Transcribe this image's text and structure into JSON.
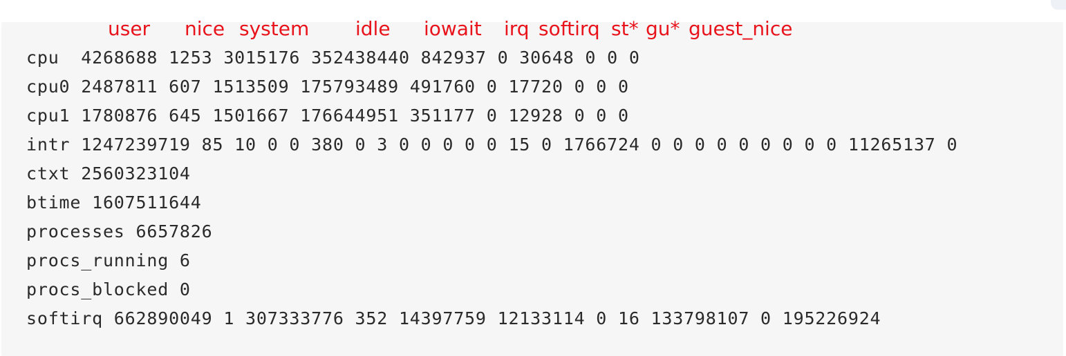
{
  "colors": {
    "header_text": "#e8131b",
    "code_text": "#2a2a2a",
    "background": "#f6f6f6"
  },
  "header_labels": [
    "user",
    "nice",
    "system",
    "idle",
    "iowait",
    "irq",
    "softirq",
    "st*",
    "gu*",
    "guest_nice"
  ],
  "lines": [
    "cpu  4268688 1253 3015176 352438440 842937 0 30648 0 0 0",
    "cpu0 2487811 607 1513509 175793489 491760 0 17720 0 0 0",
    "cpu1 1780876 645 1501667 176644951 351177 0 12928 0 0 0",
    "intr 1247239719 85 10 0 0 380 0 3 0 0 0 0 0 15 0 1766724 0 0 0 0 0 0 0 0 0 11265137 0",
    "ctxt 2560323104",
    "btime 1607511644",
    "processes 6657826",
    "procs_running 6",
    "procs_blocked 0",
    "softirq 662890049 1 307333776 352 14397759 12133114 0 16 133798107 0 195226924"
  ]
}
